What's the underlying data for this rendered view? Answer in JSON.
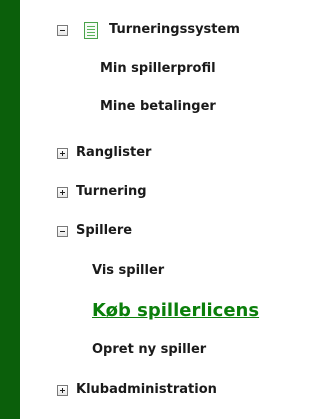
{
  "tree": {
    "root": {
      "label": "Turneringssystem",
      "expanded": true
    },
    "items": [
      {
        "label": "Min spillerprofil"
      },
      {
        "label": "Mine betalinger"
      },
      {
        "label": "Ranglister",
        "expanded": false
      },
      {
        "label": "Turnering",
        "expanded": false
      },
      {
        "label": "Spillere",
        "expanded": true
      },
      {
        "label": "Vis spiller"
      },
      {
        "label": "Køb spillerlicens",
        "active": true
      },
      {
        "label": "Opret ny spiller"
      },
      {
        "label": "Klubadministration",
        "expanded": false
      }
    ]
  },
  "colors": {
    "sidebar": "#0b5f0b",
    "active_link": "#0b7f0b",
    "text": "#1a1a1a"
  }
}
